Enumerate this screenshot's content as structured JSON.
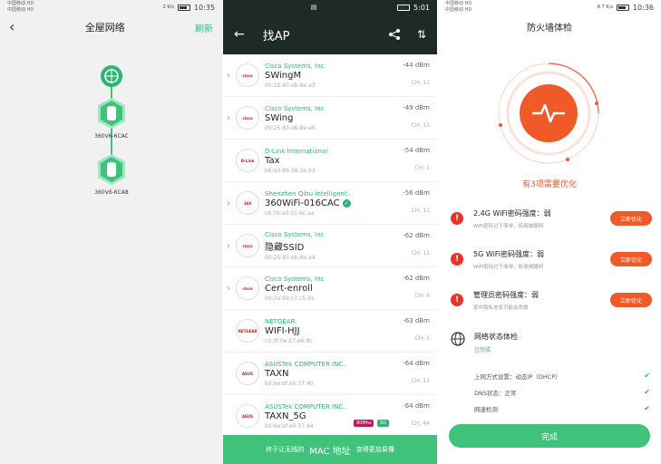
{
  "panel1": {
    "status": {
      "carrier1": "中国移动 HD",
      "carrier2": "中国移动 HD",
      "time": "10:35",
      "speed": "2 K/s"
    },
    "title": "全屋网络",
    "refresh": "刷新",
    "nodes": [
      {
        "label": "360V6-6CAC"
      },
      {
        "label": "360V6-6CA8"
      }
    ]
  },
  "panel2": {
    "status": {
      "time": "5:01"
    },
    "title": "找AP",
    "aps": [
      {
        "vendor": "Cisco Systems, Inc",
        "ssid": "SWingM",
        "mac": "00:25:83:eb:8e:a3",
        "dbm": "-44 dBm",
        "ch": "CH: 11",
        "logo": "cisco",
        "chevron": true
      },
      {
        "vendor": "Cisco Systems, Inc",
        "ssid": "SWing",
        "mac": "00:25:83:eb:8e:a0",
        "dbm": "-49 dBm",
        "ch": "CH: 11",
        "logo": "cisco",
        "chevron": true
      },
      {
        "vendor": "D-Link International",
        "ssid": "Tax",
        "mac": "b8:a3:86:38:3a:53",
        "dbm": "-54 dBm",
        "ch": "CH: 1",
        "logo": "D-Link",
        "chevron": false
      },
      {
        "vendor": "Shenzhen Qihu Intelligent...",
        "ssid": "360WiFi-016CAC",
        "mac": "c8:5b:a0:01:6c:aa",
        "dbm": "-56 dBm",
        "ch": "CH: 11",
        "logo": "360",
        "chevron": true
      },
      {
        "vendor": "Cisco Systems, Inc",
        "ssid": "隐藏SSID",
        "mac": "00:25:83:eb:8e:a4",
        "dbm": "-62 dBm",
        "ch": "CH: 11",
        "logo": "cisco",
        "chevron": true
      },
      {
        "vendor": "Cisco Systems, Inc",
        "ssid": "Cert-enroll",
        "mac": "00:3a:99:c3:c5:31",
        "dbm": "-62 dBm",
        "ch": "CH: 6",
        "logo": "cisco",
        "chevron": true
      },
      {
        "vendor": "NETGEAR",
        "ssid": "WIFI-HJJ",
        "mac": "c0:3f:0e:b7:e6:8c",
        "dbm": "-63 dBm",
        "ch": "CH: 1",
        "logo": "NETGEAR",
        "chevron": false
      },
      {
        "vendor": "ASUSTek COMPUTER INC.",
        "ssid": "TAXN",
        "mac": "b0:6e:bf:e0:37:40",
        "dbm": "-64 dBm",
        "ch": "CH: 11",
        "logo": "ASUS",
        "chevron": false
      },
      {
        "vendor": "ASUSTek COMPUTER INC.",
        "ssid": "TAXN_5G",
        "mac": "b0:6e:bf:e0:37:44",
        "dbm": "-64 dBm",
        "ch": "CH: 44",
        "logo": "ASUS",
        "chevron": false
      }
    ],
    "tags": {
      "bw": "80Mhz",
      "band": "5G"
    },
    "footer": {
      "pre": "终于让无线的",
      "mac": "MAC 地址",
      "post": "变得更加易懂"
    }
  },
  "panel3": {
    "status": {
      "time": "10:36",
      "speed": "8.7 K/s"
    },
    "title": "防火墙体检",
    "warning": "有3项需要优化",
    "items": [
      {
        "title": "2.4G WiFi密码强度：弱",
        "sub": "WiFi密码过于简单，极易被蹭网",
        "btn": "立即优化"
      },
      {
        "title": "5G WiFi密码强度：弱",
        "sub": "WiFi密码过于简单，极易被蹭网",
        "btn": "立即优化"
      },
      {
        "title": "管理员密码强度：弱",
        "sub": "家中隐私信息可能会泄露",
        "btn": "立即优化"
      }
    ],
    "net": {
      "title": "网络状态体检",
      "status": "已完成"
    },
    "subchecks": [
      {
        "label": "上网方式设置：动态IP（DHCP）"
      },
      {
        "label": "DNS状态：正常"
      },
      {
        "label": "网速检测"
      }
    ],
    "done": "完成"
  }
}
